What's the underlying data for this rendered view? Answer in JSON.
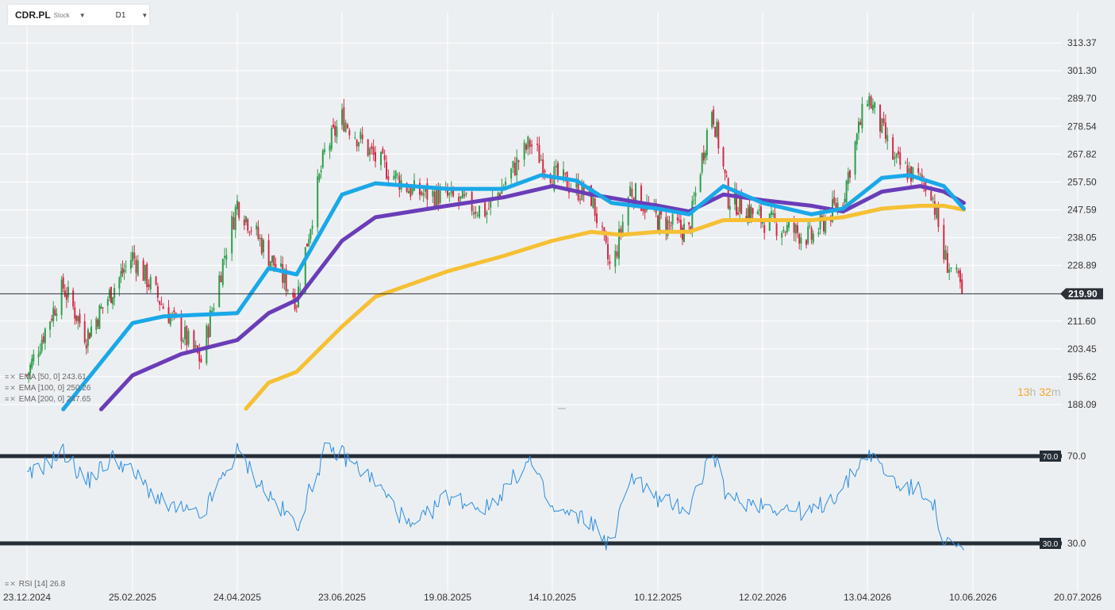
{
  "toolbar": {
    "symbol": "CDR.PL",
    "asset_type": "Stock",
    "interval": "D1",
    "symbol_dropdown_icon": "caret-down-icon",
    "interval_dropdown_icon": "caret-down-icon"
  },
  "countdown": {
    "hours": "13",
    "hours_unit": "h",
    "minutes": "32",
    "minutes_unit": "m"
  },
  "indicators": [
    {
      "label": "EMA [50, 0] 243.61",
      "color": "#1aa8e8"
    },
    {
      "label": "EMA [100, 0] 250.26",
      "color": "#6a3db8"
    },
    {
      "label": "EMA [200, 0] 247.65",
      "color": "#f5c033"
    }
  ],
  "rsi_label": "RSI [14] 26.8",
  "colors": {
    "background": "#eceff2",
    "candle_up": "#2e9e4a",
    "candle_down": "#d42a48",
    "ema50": "#1aa8e8",
    "ema100": "#6a3db8",
    "ema200": "#f5c033",
    "rsi_line": "#2b8de0",
    "level_line": "#252d36",
    "price_tag_bg": "#2b3138"
  },
  "chart_data": [
    {
      "type": "candlestick",
      "title": "",
      "x_ticks": [
        "23.12.2024",
        "25.02.2025",
        "24.04.2025",
        "23.06.2025",
        "19.08.2025",
        "14.10.2025",
        "10.12.2025",
        "12.02.2026",
        "13.04.2026",
        "10.06.2026",
        "20.07.2026"
      ],
      "y_ticks": [
        "313.37",
        "301.30",
        "289.70",
        "278.54",
        "267.82",
        "257.50",
        "247.59",
        "238.05",
        "228.89",
        "211.60",
        "203.45",
        "195.62",
        "188.09"
      ],
      "ylim": [
        188.09,
        313.37
      ],
      "y_scale": "log",
      "last_price": "219.90",
      "waypoints": [
        [
          "23.12.2024",
          196
        ],
        [
          "14.01.2025",
          222
        ],
        [
          "28.01.2025",
          207
        ],
        [
          "25.02.2025",
          232
        ],
        [
          "14.03.2025",
          216
        ],
        [
          "04.04.2025",
          200
        ],
        [
          "24.04.2025",
          250
        ],
        [
          "12.05.2025",
          232
        ],
        [
          "28.05.2025",
          218
        ],
        [
          "13.06.2025",
          268
        ],
        [
          "23.06.2025",
          282
        ],
        [
          "11.07.2025",
          266
        ],
        [
          "31.07.2025",
          254
        ],
        [
          "19.08.2025",
          252
        ],
        [
          "09.09.2025",
          247
        ],
        [
          "02.10.2025",
          272
        ],
        [
          "14.10.2025",
          260
        ],
        [
          "04.11.2025",
          252
        ],
        [
          "15.11.2025",
          226
        ],
        [
          "25.11.2025",
          255
        ],
        [
          "10.12.2025",
          244
        ],
        [
          "29.12.2025",
          240
        ],
        [
          "12.01.2026",
          286
        ],
        [
          "22.01.2026",
          252
        ],
        [
          "12.02.2026",
          244
        ],
        [
          "12.03.2026",
          238
        ],
        [
          "30.03.2026",
          252
        ],
        [
          "13.04.2026",
          291
        ],
        [
          "28.04.2026",
          265
        ],
        [
          "18.05.2026",
          255
        ],
        [
          "25.05.2026",
          232
        ],
        [
          "05.06.2026",
          220
        ]
      ],
      "ema50": [
        [
          "14.01.2025",
          186
        ],
        [
          "25.02.2025",
          211
        ],
        [
          "14.03.2025",
          213
        ],
        [
          "24.04.2025",
          214
        ],
        [
          "12.05.2025",
          228
        ],
        [
          "28.05.2025",
          226
        ],
        [
          "23.06.2025",
          253
        ],
        [
          "11.07.2025",
          257
        ],
        [
          "19.08.2025",
          255
        ],
        [
          "18.09.2025",
          255
        ],
        [
          "08.10.2025",
          260
        ],
        [
          "27.10.2025",
          258
        ],
        [
          "15.11.2025",
          250
        ],
        [
          "10.12.2025",
          248
        ],
        [
          "29.12.2025",
          246
        ],
        [
          "19.01.2026",
          256
        ],
        [
          "12.02.2026",
          250
        ],
        [
          "12.03.2026",
          246
        ],
        [
          "30.03.2026",
          248
        ],
        [
          "21.04.2026",
          259
        ],
        [
          "06.05.2026",
          260
        ],
        [
          "25.05.2026",
          256
        ],
        [
          "05.06.2026",
          248
        ]
      ],
      "ema100": [
        [
          "06.02.2025",
          186
        ],
        [
          "25.02.2025",
          196
        ],
        [
          "24.03.2025",
          202
        ],
        [
          "24.04.2025",
          206
        ],
        [
          "12.05.2025",
          214
        ],
        [
          "28.05.2025",
          218
        ],
        [
          "23.06.2025",
          237
        ],
        [
          "11.07.2025",
          245
        ],
        [
          "19.08.2025",
          249
        ],
        [
          "18.09.2025",
          252
        ],
        [
          "14.10.2025",
          256
        ],
        [
          "04.11.2025",
          253
        ],
        [
          "10.12.2025",
          249
        ],
        [
          "29.12.2025",
          247
        ],
        [
          "19.01.2026",
          253
        ],
        [
          "12.02.2026",
          251
        ],
        [
          "12.03.2026",
          249
        ],
        [
          "30.03.2026",
          247
        ],
        [
          "21.04.2026",
          254
        ],
        [
          "12.05.2026",
          256
        ],
        [
          "25.05.2026",
          254
        ],
        [
          "05.06.2026",
          250
        ]
      ],
      "ema200": [
        [
          "29.04.2025",
          187
        ],
        [
          "12.05.2025",
          194
        ],
        [
          "28.05.2025",
          197
        ],
        [
          "23.06.2025",
          210
        ],
        [
          "11.07.2025",
          219
        ],
        [
          "19.08.2025",
          227
        ],
        [
          "18.09.2025",
          232
        ],
        [
          "14.10.2025",
          237
        ],
        [
          "04.11.2025",
          240
        ],
        [
          "20.11.2025",
          239
        ],
        [
          "10.12.2025",
          240
        ],
        [
          "29.12.2025",
          240
        ],
        [
          "19.01.2026",
          244
        ],
        [
          "12.02.2026",
          244
        ],
        [
          "12.03.2026",
          244
        ],
        [
          "30.03.2026",
          245
        ],
        [
          "21.04.2026",
          248
        ],
        [
          "12.05.2026",
          249
        ],
        [
          "25.05.2026",
          249
        ],
        [
          "05.06.2026",
          247.65
        ]
      ]
    },
    {
      "type": "line",
      "title": "",
      "y_ticks": [
        "70.0",
        "30.0"
      ],
      "ylim": [
        20,
        80
      ],
      "levels": [
        70,
        30
      ],
      "rsi": [
        [
          "23.12.2024",
          60
        ],
        [
          "14.01.2025",
          72
        ],
        [
          "28.01.2025",
          58
        ],
        [
          "14.02.2025",
          70
        ],
        [
          "28.02.2025",
          60
        ],
        [
          "14.03.2025",
          48
        ],
        [
          "04.04.2025",
          42
        ],
        [
          "24.04.2025",
          72
        ],
        [
          "12.05.2025",
          52
        ],
        [
          "28.05.2025",
          38
        ],
        [
          "13.06.2025",
          72
        ],
        [
          "23.06.2025",
          71
        ],
        [
          "11.07.2025",
          58
        ],
        [
          "31.07.2025",
          36
        ],
        [
          "19.08.2025",
          52
        ],
        [
          "09.09.2025",
          46
        ],
        [
          "02.10.2025",
          68
        ],
        [
          "14.10.2025",
          45
        ],
        [
          "04.11.2025",
          40
        ],
        [
          "15.11.2025",
          28
        ],
        [
          "25.11.2025",
          62
        ],
        [
          "10.12.2025",
          50
        ],
        [
          "29.12.2025",
          46
        ],
        [
          "12.01.2026",
          72
        ],
        [
          "22.01.2026",
          50
        ],
        [
          "12.02.2026",
          48
        ],
        [
          "12.03.2026",
          44
        ],
        [
          "30.03.2026",
          55
        ],
        [
          "13.04.2026",
          72
        ],
        [
          "28.04.2026",
          58
        ],
        [
          "18.05.2026",
          52
        ],
        [
          "25.05.2026",
          30
        ],
        [
          "05.06.2026",
          26.8
        ]
      ]
    }
  ]
}
